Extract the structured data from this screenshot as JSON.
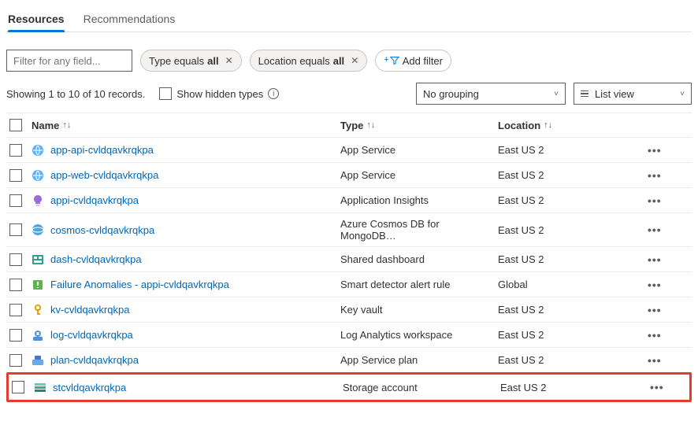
{
  "tabs": {
    "resources": "Resources",
    "recommendations": "Recommendations"
  },
  "filter": {
    "placeholder": "Filter for any field...",
    "type_pill_prefix": "Type equals ",
    "type_pill_value": "all",
    "loc_pill_prefix": "Location equals ",
    "loc_pill_value": "all",
    "add_filter": "Add filter"
  },
  "toolbar": {
    "showing": "Showing 1 to 10 of 10 records.",
    "show_hidden": "Show hidden types",
    "grouping": "No grouping",
    "view": "List view"
  },
  "columns": {
    "name": "Name",
    "type": "Type",
    "location": "Location"
  },
  "rows": [
    {
      "name": "app-api-cvldqavkrqkpa",
      "type": "App Service",
      "location": "East US 2",
      "icon": "appservice"
    },
    {
      "name": "app-web-cvldqavkrqkpa",
      "type": "App Service",
      "location": "East US 2",
      "icon": "appservice"
    },
    {
      "name": "appi-cvldqavkrqkpa",
      "type": "Application Insights",
      "location": "East US 2",
      "icon": "appinsights"
    },
    {
      "name": "cosmos-cvldqavkrqkpa",
      "type": "Azure Cosmos DB for MongoDB…",
      "location": "East US 2",
      "icon": "cosmos"
    },
    {
      "name": "dash-cvldqavkrqkpa",
      "type": "Shared dashboard",
      "location": "East US 2",
      "icon": "dashboard"
    },
    {
      "name": "Failure Anomalies - appi-cvldqavkrqkpa",
      "type": "Smart detector alert rule",
      "location": "Global",
      "icon": "alert"
    },
    {
      "name": "kv-cvldqavkrqkpa",
      "type": "Key vault",
      "location": "East US 2",
      "icon": "keyvault"
    },
    {
      "name": "log-cvldqavkrqkpa",
      "type": "Log Analytics workspace",
      "location": "East US 2",
      "icon": "log"
    },
    {
      "name": "plan-cvldqavkrqkpa",
      "type": "App Service plan",
      "location": "East US 2",
      "icon": "plan"
    },
    {
      "name": "stcvldqavkrqkpa",
      "type": "Storage account",
      "location": "East US 2",
      "icon": "storage"
    }
  ]
}
